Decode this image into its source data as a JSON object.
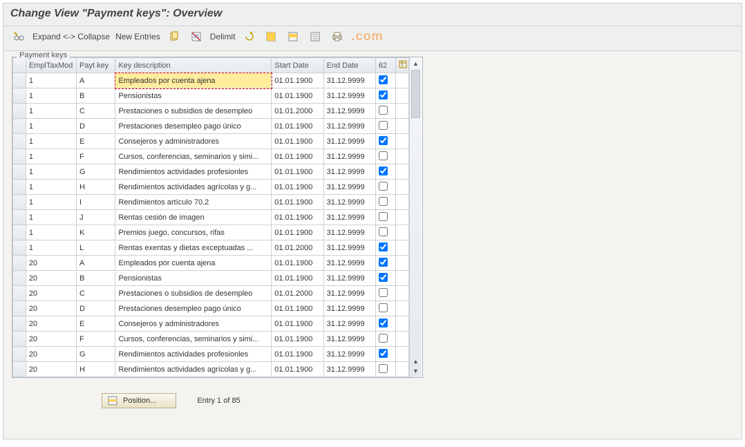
{
  "title": "Change View \"Payment keys\": Overview",
  "toolbar": {
    "expand_collapse": "Expand <-> Collapse",
    "new_entries": "New Entries",
    "delimit": "Delimit"
  },
  "watermark": ".com",
  "panel": {
    "legend": "Payment keys"
  },
  "columns": {
    "mod": "EmplTaxMod",
    "key": "Payt key",
    "desc": "Key description",
    "start": "Start Date",
    "end": "End Date",
    "chk": "62"
  },
  "rows": [
    {
      "mod": "1",
      "key": "A",
      "desc": "Empleados por cuenta ajena",
      "start": "01.01.1900",
      "end": "31.12.9999",
      "chk": true,
      "active": true
    },
    {
      "mod": "1",
      "key": "B",
      "desc": "Pensionistas",
      "start": "01.01.1900",
      "end": "31.12.9999",
      "chk": true
    },
    {
      "mod": "1",
      "key": "C",
      "desc": "Prestaciones o subsidios de desempleo",
      "start": "01.01.2000",
      "end": "31.12.9999",
      "chk": false
    },
    {
      "mod": "1",
      "key": "D",
      "desc": "Prestaciones desempleo pago único",
      "start": "01.01.1900",
      "end": "31.12.9999",
      "chk": false
    },
    {
      "mod": "1",
      "key": "E",
      "desc": "Consejeros y administradores",
      "start": "01.01.1900",
      "end": "31.12.9999",
      "chk": true
    },
    {
      "mod": "1",
      "key": "F",
      "desc": "Cursos, conferencias, seminarios y simi...",
      "start": "01.01.1900",
      "end": "31.12.9999",
      "chk": false
    },
    {
      "mod": "1",
      "key": "G",
      "desc": "Rendimientos actividades profesionles",
      "start": "01.01.1900",
      "end": "31.12.9999",
      "chk": true
    },
    {
      "mod": "1",
      "key": "H",
      "desc": "Rendimientos actividades agrícolas y g...",
      "start": "01.01.1900",
      "end": "31.12.9999",
      "chk": false
    },
    {
      "mod": "1",
      "key": "I",
      "desc": "Rendimientos artículo 70.2",
      "start": "01.01.1900",
      "end": "31.12.9999",
      "chk": false
    },
    {
      "mod": "1",
      "key": "J",
      "desc": "Rentas cesión de imagen",
      "start": "01.01.1900",
      "end": "31.12.9999",
      "chk": false
    },
    {
      "mod": "1",
      "key": "K",
      "desc": "Premios juego, concursos, rifas",
      "start": "01.01.1900",
      "end": "31.12.9999",
      "chk": false
    },
    {
      "mod": "1",
      "key": "L",
      "desc": "Rentas exentas y dietas exceptuadas ...",
      "start": "01.01.2000",
      "end": "31.12.9999",
      "chk": true
    },
    {
      "mod": "20",
      "key": "A",
      "desc": "Empleados por cuenta ajena",
      "start": "01.01.1900",
      "end": "31.12.9999",
      "chk": true
    },
    {
      "mod": "20",
      "key": "B",
      "desc": "Pensionistas",
      "start": "01.01.1900",
      "end": "31.12.9999",
      "chk": true
    },
    {
      "mod": "20",
      "key": "C",
      "desc": "Prestaciones o subsidios de desempleo",
      "start": "01.01.2000",
      "end": "31.12.9999",
      "chk": false
    },
    {
      "mod": "20",
      "key": "D",
      "desc": "Prestaciones desempleo pago único",
      "start": "01.01.1900",
      "end": "31.12.9999",
      "chk": false
    },
    {
      "mod": "20",
      "key": "E",
      "desc": "Consejeros y administradores",
      "start": "01.01.1900",
      "end": "31.12.9999",
      "chk": true
    },
    {
      "mod": "20",
      "key": "F",
      "desc": "Cursos, conferencias, seminarios y simi...",
      "start": "01.01.1900",
      "end": "31.12.9999",
      "chk": false
    },
    {
      "mod": "20",
      "key": "G",
      "desc": "Rendimientos actividades profesionles",
      "start": "01.01.1900",
      "end": "31.12.9999",
      "chk": true
    },
    {
      "mod": "20",
      "key": "H",
      "desc": "Rendimientos actividades agrícolas y g...",
      "start": "01.01.1900",
      "end": "31.12.9999",
      "chk": false
    }
  ],
  "footer": {
    "position_label": "Position...",
    "entry_status": "Entry 1 of 85"
  }
}
